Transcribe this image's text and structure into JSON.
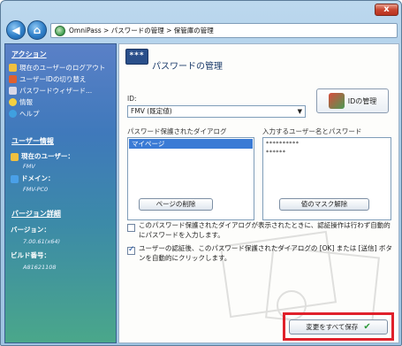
{
  "window": {
    "close_label": "x",
    "address": "OmniPass > パスワードの管理 > 保管庫の管理"
  },
  "sidebar": {
    "actions_title": "アクション",
    "actions": [
      {
        "label": "現在のユーザーのログアウト",
        "icon": "user-logout-icon"
      },
      {
        "label": "ユーザーIDの切り替え",
        "icon": "switch-user-icon"
      },
      {
        "label": "パスワードウィザード...",
        "icon": "wizard-icon"
      },
      {
        "label": "情報",
        "icon": "info-icon"
      },
      {
        "label": "ヘルプ",
        "icon": "help-icon"
      }
    ],
    "user_info_title": "ユーザー情報",
    "current_user_label": "現在のユーザー：",
    "current_user_value": "FMV",
    "domain_label": "ドメイン：",
    "domain_value": "FMV-PC0",
    "version_title": "バージョン詳細",
    "version_label": "バージョン：",
    "version_value": "7.00.61(x64)",
    "build_label": "ビルド番号：",
    "build_value": "A81621108"
  },
  "main": {
    "header_icon_text": "***",
    "title": "パスワードの管理",
    "id_label": "ID:",
    "id_value": "FMV (既定値)",
    "id_button": "IDの管理",
    "dialog_list_label": "パスワード保護されたダイアログ",
    "dialog_list": [
      "マイページ"
    ],
    "cred_label": "入力するユーザー名とパスワード",
    "cred_lines": [
      "**********",
      "******"
    ],
    "delete_page_button": "ページの削除",
    "unmask_button": "値のマスク解除",
    "option1": "このパスワード保護されたダイアログが表示されたときに、認証操作は行わず自動的にパスワードを入力します。",
    "option1_checked": false,
    "option2": "ユーザーの認証後、このパスワード保護されたダイアログの [OK] または [送信] ボタンを自動的にクリックします。",
    "option2_checked": true,
    "save_button": "変更をすべて保存"
  },
  "colors": {
    "highlight": "#e0202a",
    "selection": "#3a7bd5"
  }
}
